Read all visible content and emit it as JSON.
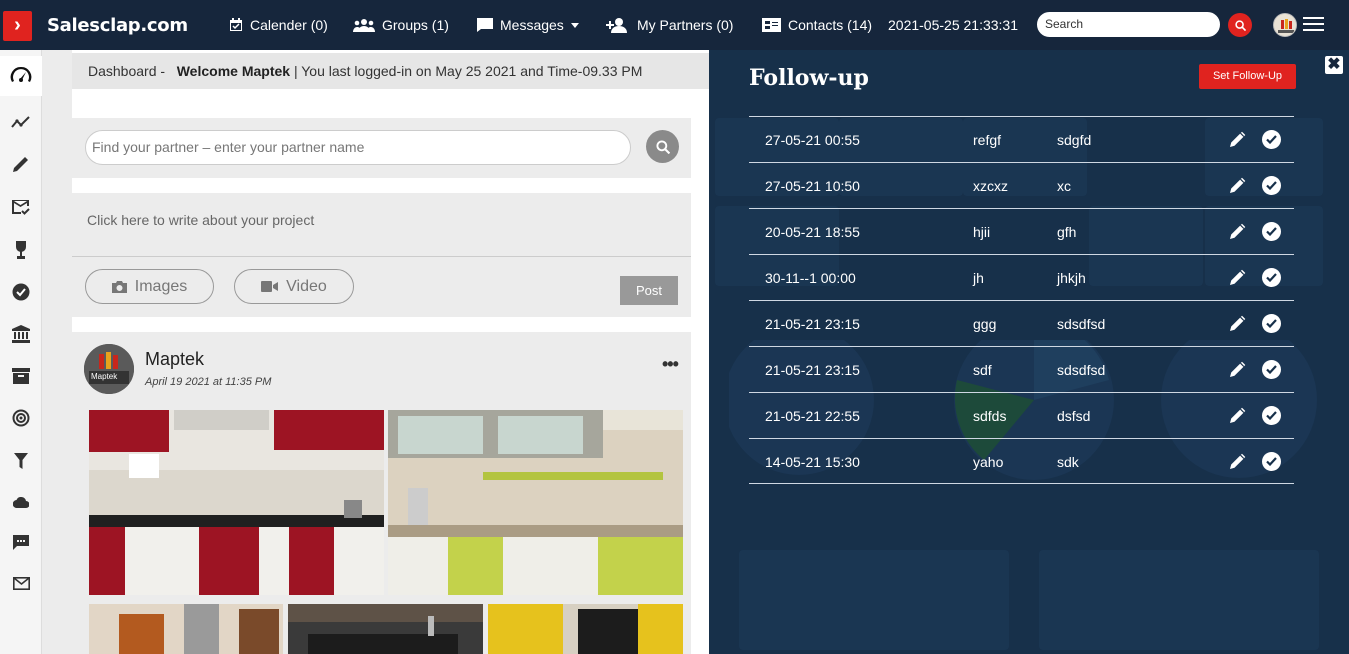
{
  "topbar": {
    "brand": "Salesclap.com",
    "nav": {
      "calendar": "Calender (0)",
      "groups": "Groups (1)",
      "messages": "Messages",
      "partners": "My Partners (0)",
      "contacts": "Contacts (14)"
    },
    "datetime": "2021-05-25 21:33:31",
    "search_placeholder": "Search"
  },
  "sidebar": {
    "icons": [
      "dashboard-icon",
      "trend-icon",
      "pencil-icon",
      "mail-check-icon",
      "award-icon",
      "check-circle-icon",
      "bank-icon",
      "archive-icon",
      "target-icon",
      "filter-icon",
      "cloud-icon",
      "chat-icon",
      "envelope-icon"
    ]
  },
  "dashboard": {
    "crumb_prefix": "Dashboard -",
    "crumb_welcome": "Welcome Maptek",
    "crumb_suffix": "| You last logged-in on May 25 2021 and Time-09.33 PM",
    "partner_placeholder": "Find your partner – enter your partner name",
    "project_placeholder": "Click here to write about your project",
    "images_label": "Images",
    "video_label": "Video",
    "post_label": "Post",
    "post": {
      "author": "Maptek",
      "logo_text": "Maptek",
      "date": "April 19 2021 at 11:35 PM",
      "more": "•••"
    }
  },
  "followup": {
    "title": "Follow-up",
    "set_button": "Set Follow-Up",
    "close": "✖",
    "rows": [
      {
        "datetime": "27-05-21 00:55",
        "name": "refgf",
        "note": "sdgfd"
      },
      {
        "datetime": "27-05-21 10:50",
        "name": "xzcxz",
        "note": "xc"
      },
      {
        "datetime": "20-05-21 18:55",
        "name": "hjii",
        "note": "gfh"
      },
      {
        "datetime": "30-11--1 00:00",
        "name": "jh",
        "note": "jhkjh"
      },
      {
        "datetime": "21-05-21 23:15",
        "name": "ggg",
        "note": "sdsdfsd"
      },
      {
        "datetime": "21-05-21 23:15",
        "name": "sdf",
        "note": "sdsdfsd"
      },
      {
        "datetime": "21-05-21 22:55",
        "name": "sdfds",
        "note": "dsfsd"
      },
      {
        "datetime": "14-05-21 15:30",
        "name": "yaho",
        "note": "sdk"
      }
    ]
  },
  "colors": {
    "navy": "#16263c",
    "accent_red": "#e0231f",
    "overlay": "#17304a"
  }
}
